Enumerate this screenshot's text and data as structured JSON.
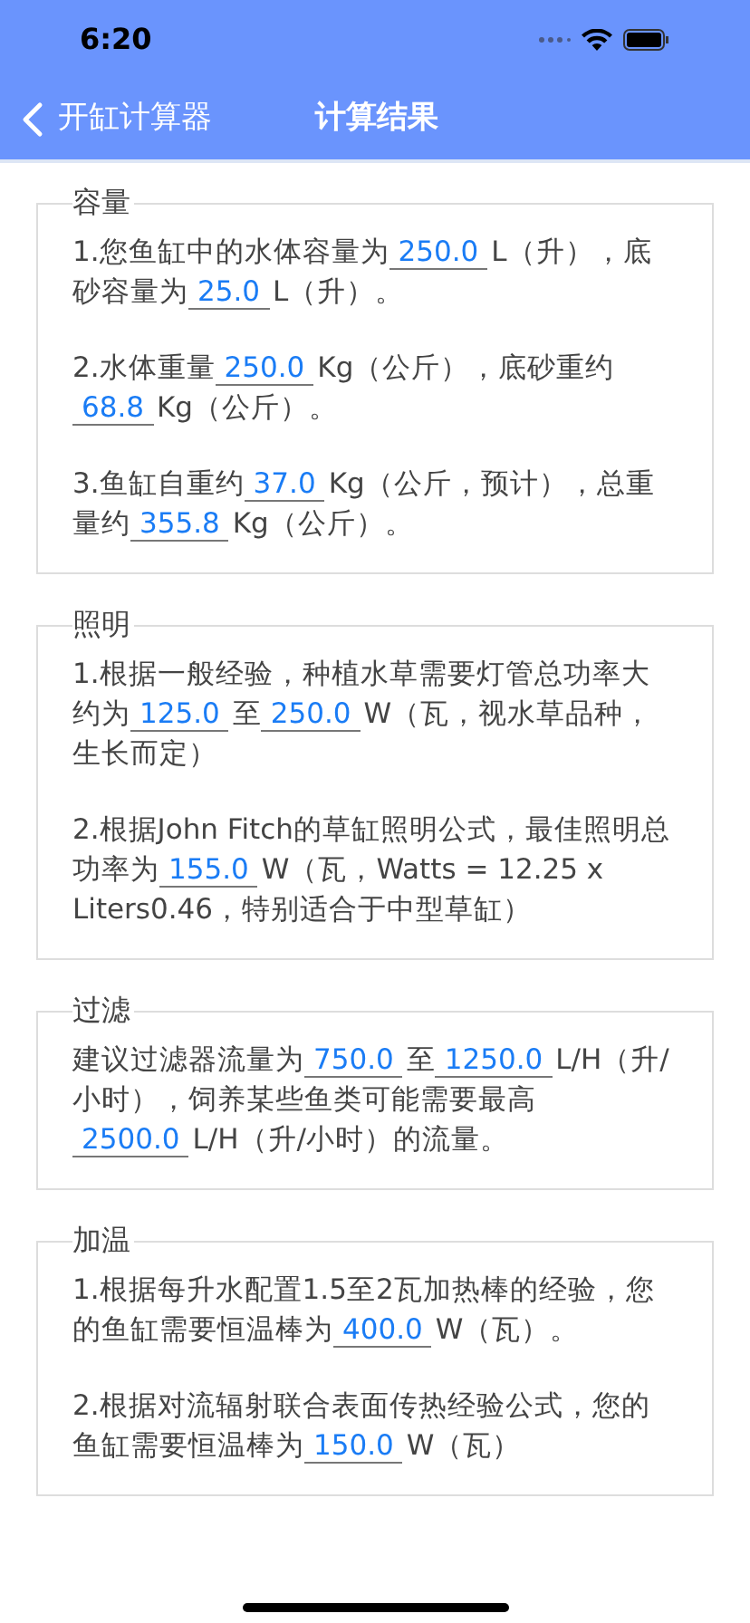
{
  "status_bar": {
    "time": "6:20"
  },
  "nav": {
    "back_label": "开缸计算器",
    "title": "计算结果"
  },
  "sections": [
    {
      "title": "容量",
      "paragraphs": [
        [
          {
            "kind": "text",
            "text": "1.您鱼缸中的水体容量为"
          },
          {
            "kind": "value",
            "text": "250.0"
          },
          {
            "kind": "text",
            "text": "L（升），底砂容量为"
          },
          {
            "kind": "value",
            "text": "25.0"
          },
          {
            "kind": "text",
            "text": "L（升）。"
          }
        ],
        [
          {
            "kind": "text",
            "text": "2.水体重量"
          },
          {
            "kind": "value",
            "text": "250.0"
          },
          {
            "kind": "text",
            "text": "Kg（公斤），底砂重约"
          },
          {
            "kind": "value",
            "text": "68.8"
          },
          {
            "kind": "text",
            "text": "Kg（公斤）。"
          }
        ],
        [
          {
            "kind": "text",
            "text": "3.鱼缸自重约"
          },
          {
            "kind": "value",
            "text": "37.0"
          },
          {
            "kind": "text",
            "text": "Kg（公斤，预计），总重量约"
          },
          {
            "kind": "value",
            "text": "355.8"
          },
          {
            "kind": "text",
            "text": "Kg（公斤）。"
          }
        ]
      ]
    },
    {
      "title": "照明",
      "paragraphs": [
        [
          {
            "kind": "text",
            "text": "1.根据一般经验，种植水草需要灯管总功率大约为"
          },
          {
            "kind": "value",
            "text": "125.0"
          },
          {
            "kind": "text",
            "text": "至"
          },
          {
            "kind": "value",
            "text": "250.0"
          },
          {
            "kind": "text",
            "text": "W（瓦，视水草品种，生长而定）"
          }
        ],
        [
          {
            "kind": "text",
            "text": "2.根据John Fitch的草缸照明公式，最佳照明总功率为"
          },
          {
            "kind": "value",
            "text": "155.0"
          },
          {
            "kind": "text",
            "text": "W（瓦，Watts = 12.25 x Liters0.46，特别适合于中型草缸）"
          }
        ]
      ]
    },
    {
      "title": "过滤",
      "paragraphs": [
        [
          {
            "kind": "text",
            "text": "建议过滤器流量为"
          },
          {
            "kind": "value",
            "text": "750.0"
          },
          {
            "kind": "text",
            "text": "至"
          },
          {
            "kind": "value",
            "text": "1250.0"
          },
          {
            "kind": "text",
            "text": "L/H（升/小时），饲养某些鱼类可能需要最高"
          },
          {
            "kind": "value",
            "text": "2500.0"
          },
          {
            "kind": "text",
            "text": "L/H（升/小时）的流量。"
          }
        ]
      ]
    },
    {
      "title": "加温",
      "paragraphs": [
        [
          {
            "kind": "text",
            "text": "1.根据每升水配置1.5至2瓦加热棒的经验，您的鱼缸需要恒温棒为"
          },
          {
            "kind": "value",
            "text": "400.0"
          },
          {
            "kind": "text",
            "text": "W（瓦）。"
          }
        ],
        [
          {
            "kind": "text",
            "text": "2.根据对流辐射联合表面传热经验公式，您的鱼缸需要恒温棒为"
          },
          {
            "kind": "value",
            "text": "150.0"
          },
          {
            "kind": "text",
            "text": "W（瓦）"
          }
        ]
      ]
    }
  ]
}
